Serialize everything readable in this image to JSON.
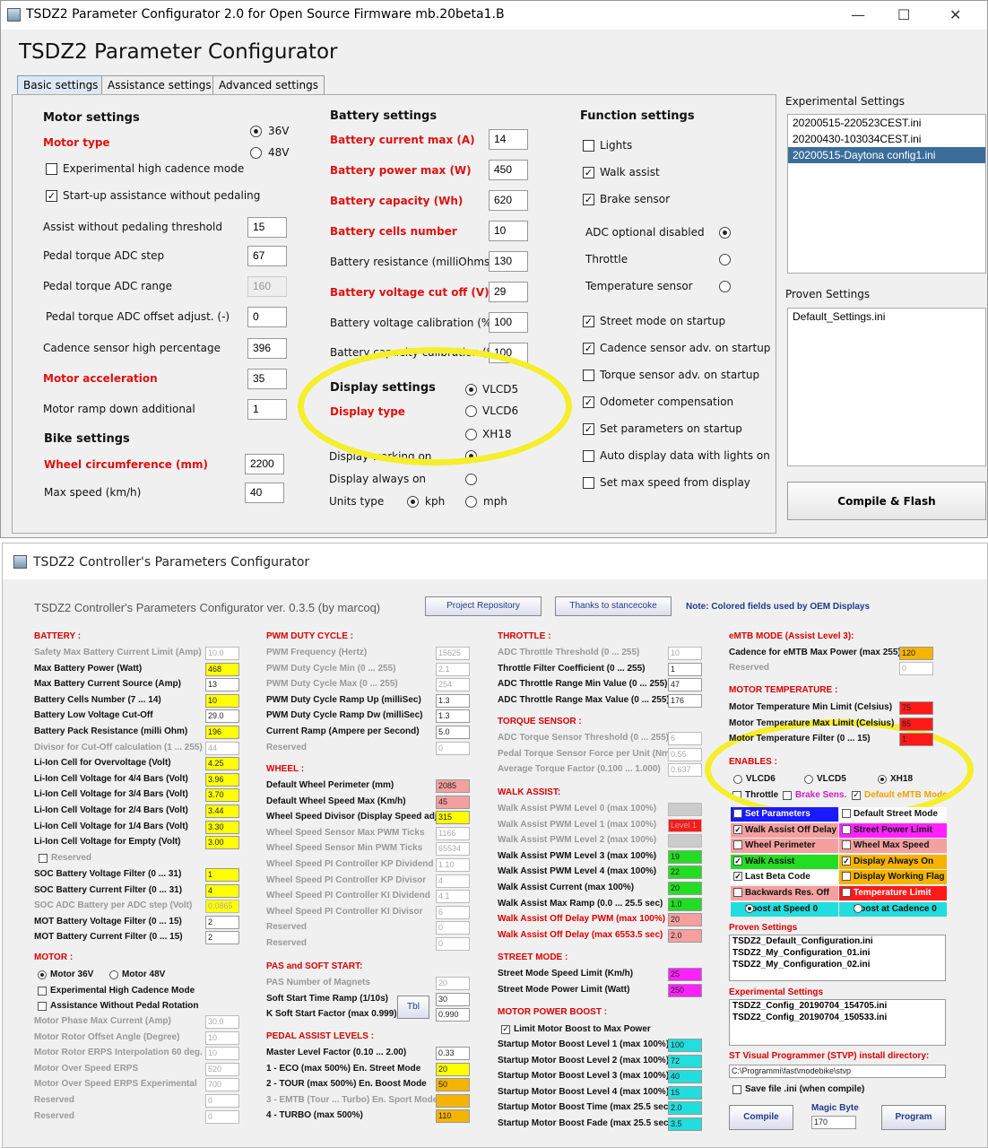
{
  "win1": {
    "title": "TSDZ2 Parameter Configurator 2.0 for Open Source Firmware mb.20beta1.B",
    "heading": "TSDZ2 Parameter Configurator",
    "tabs": [
      "Basic settings",
      "Assistance settings",
      "Advanced settings"
    ],
    "motor": {
      "heading": "Motor settings",
      "motor_type": "Motor type",
      "v36": "36V",
      "v48": "48V",
      "exp_cadence": "Experimental high cadence mode",
      "startup_assist": "Start-up assistance without pedaling",
      "fields": [
        {
          "label": "Assist without pedaling threshold",
          "value": "15"
        },
        {
          "label": "Pedal torque ADC step",
          "value": "67"
        },
        {
          "label": "Pedal torque ADC range",
          "value": "160"
        },
        {
          "label": "Pedal torque ADC offset adjust. (-)",
          "value": "0"
        },
        {
          "label": "Cadence sensor high percentage",
          "value": "396"
        },
        {
          "label": "Motor acceleration",
          "value": "35"
        },
        {
          "label": "Motor ramp down additional",
          "value": "1"
        }
      ]
    },
    "bike": {
      "heading": "Bike settings",
      "wheel_label": "Wheel circumference (mm)",
      "wheel_value": "2200",
      "speed_label": "Max speed (km/h)",
      "speed_value": "40"
    },
    "battery": {
      "heading": "Battery settings",
      "fields": [
        {
          "label": "Battery current max (A)",
          "value": "14"
        },
        {
          "label": "Battery power max (W)",
          "value": "450"
        },
        {
          "label": "Battery capacity (Wh)",
          "value": "620"
        },
        {
          "label": "Battery cells number",
          "value": "10"
        },
        {
          "label": "Battery resistance (milliOhms)",
          "value": "130"
        },
        {
          "label": "Battery voltage cut off (V)",
          "value": "29"
        },
        {
          "label": "Battery voltage calibration (%)",
          "value": "100"
        },
        {
          "label": "Battery capacity calibration (%)",
          "value": "100"
        }
      ]
    },
    "display": {
      "heading": "Display settings",
      "type_label": "Display type",
      "options": [
        "VLCD5",
        "VLCD6",
        "XH18"
      ],
      "working_on": "Display working on",
      "always_on": "Display always on",
      "units": "Units type",
      "kph": "kph",
      "mph": "mph"
    },
    "functions": {
      "heading": "Function settings",
      "lights": "Lights",
      "walk": "Walk assist",
      "brake": "Brake sensor",
      "adc_disabled": "ADC optional disabled",
      "throttle": "Throttle",
      "temp": "Temperature sensor",
      "street": "Street mode on startup",
      "cadence_adv": "Cadence sensor adv. on startup",
      "torque_adv": "Torque sensor adv. on startup",
      "odometer": "Odometer compensation",
      "set_params": "Set parameters on startup",
      "auto_display": "Auto display data with lights on",
      "max_speed_display": "Set max speed from display"
    },
    "experimental": {
      "heading": "Experimental Settings",
      "items": [
        "20200515-220523CEST.ini",
        "20200430-103034CEST.ini",
        "20200515-Daytona config1.ini"
      ]
    },
    "proven": {
      "heading": "Proven Settings",
      "items": [
        "Default_Settings.ini"
      ]
    },
    "compile": "Compile & Flash"
  },
  "win2": {
    "title": "TSDZ2 Controller's Parameters Configurator",
    "heading": "TSDZ2 Controller's Parameters Configurator ver. 0.3.5 (by marcoq)",
    "repo_btn": "Project Repository",
    "thanks_btn": "Thanks to stancecoke",
    "note": "Note: Colored fields used by OEM Displays",
    "battery": {
      "heading": "BATTERY :",
      "rows": [
        {
          "l": "Safety Max Battery Current Limit (Amp)",
          "v": "10.0"
        },
        {
          "l": "Max Battery Power (Watt)",
          "v": "468"
        },
        {
          "l": "Max Battery Current Source (Amp)",
          "v": "13"
        },
        {
          "l": "Battery Cells Number (7 ... 14)",
          "v": "10"
        },
        {
          "l": "Battery Low Voltage Cut-Off",
          "v": "29.0"
        },
        {
          "l": "Battery Pack Resistance (milli Ohm)",
          "v": "196"
        },
        {
          "l": "Divisor for Cut-Off calculation (1 ... 255)",
          "v": "44"
        },
        {
          "l": "Li-Ion Cell for Overvoltage (Volt)",
          "v": "4.25"
        },
        {
          "l": "Li-Ion Cell Voltage for 4/4 Bars (Volt)",
          "v": "3.96"
        },
        {
          "l": "Li-Ion Cell Voltage for 3/4 Bars (Volt)",
          "v": "3.70"
        },
        {
          "l": "Li-Ion Cell Voltage for 2/4 Bars (Volt)",
          "v": "3.44"
        },
        {
          "l": "Li-Ion Cell Voltage for 1/4 Bars (Volt)",
          "v": "3.30"
        },
        {
          "l": "Li-Ion Cell Voltage for Empty (Volt)",
          "v": "3.00"
        }
      ],
      "reserved": "Reserved",
      "rows2": [
        {
          "l": "SOC Battery Voltage Filter (0 ... 31)",
          "v": "1"
        },
        {
          "l": "SOC Battery Current Filter (0 ... 31)",
          "v": "4"
        },
        {
          "l": "SOC ADC Battery per ADC step (Volt)",
          "v": "0.0865"
        },
        {
          "l": "MOT Battery Voltage Filter (0 ... 15)",
          "v": "2"
        },
        {
          "l": "MOT Battery Current Filter (0 ... 15)",
          "v": "2"
        }
      ]
    },
    "motor": {
      "heading": "MOTOR :",
      "m36": "Motor 36V",
      "m48": "Motor 48V",
      "exp": "Experimental High Cadence Mode",
      "assist": "Assistance Without Pedal Rotation",
      "rows": [
        {
          "l": "Motor Phase Max Current (Amp)",
          "v": "30.0"
        },
        {
          "l": "Motor Rotor Offset Angle (Degree)",
          "v": "10"
        },
        {
          "l": "Motor Rotor ERPS Interpolation 60 deg.",
          "v": "10"
        },
        {
          "l": "Motor Over Speed ERPS",
          "v": "520"
        },
        {
          "l": "Motor Over Speed ERPS Experimental",
          "v": "700"
        },
        {
          "l": "Reserved",
          "v": "0"
        },
        {
          "l": "Reserved",
          "v": "0"
        }
      ]
    },
    "pwm": {
      "heading": "PWM DUTY CYCLE :",
      "rows": [
        {
          "l": "PWM Frequency (Hertz)",
          "v": "15625"
        },
        {
          "l": "PWM Duty Cycle Min (0 ... 255)",
          "v": "2.1"
        },
        {
          "l": "PWM Duty Cycle Max (0 ... 255)",
          "v": "254"
        },
        {
          "l": "PWM Duty Cycle Ramp Up (milliSec)",
          "v": "1.3"
        },
        {
          "l": "PWM Duty Cycle Ramp Dw (milliSec)",
          "v": "1.3"
        },
        {
          "l": "Current Ramp (Ampere per Second)",
          "v": "5.0"
        },
        {
          "l": "Reserved",
          "v": "0"
        }
      ]
    },
    "wheel": {
      "heading": "WHEEL :",
      "rows": [
        {
          "l": "Default Wheel Perimeter (mm)",
          "v": "2085"
        },
        {
          "l": "Default Wheel Speed Max (Km/h)",
          "v": "45"
        },
        {
          "l": "Wheel Speed Divisor (Display Speed adj)",
          "v": "315"
        },
        {
          "l": "Wheel Speed Sensor Max PWM Ticks",
          "v": "1166"
        },
        {
          "l": "Wheel Speed Sensor Min PWM Ticks",
          "v": "65534"
        },
        {
          "l": "Wheel Speed PI Controller KP Dividend",
          "v": "1.10"
        },
        {
          "l": "Wheel Speed PI Controller KP Divisor",
          "v": "4"
        },
        {
          "l": "Wheel Speed PI Controller KI Dividend",
          "v": "4.1"
        },
        {
          "l": "Wheel Speed PI Controller KI Divisor",
          "v": "6"
        },
        {
          "l": "Reserved",
          "v": "0"
        },
        {
          "l": "Reserved",
          "v": "0"
        }
      ]
    },
    "pas": {
      "heading": "PAS and SOFT START:",
      "rows": [
        {
          "l": "PAS Number of Magnets",
          "v": "20"
        },
        {
          "l": "Soft Start Time Ramp (1/10s)",
          "v": "30"
        },
        {
          "l": "K Soft Start Factor (max 0.999)",
          "v": "0.990"
        }
      ],
      "tbl": "Tbl"
    },
    "pedal": {
      "heading": "PEDAL ASSIST LEVELS :",
      "rows": [
        {
          "l": "Master Level Factor (0.10 ... 2.00)",
          "v": "0.33"
        },
        {
          "l": "1 - ECO    (max 500%) En. Street Mode",
          "v": "20"
        },
        {
          "l": "2 - TOUR  (max 500%) En. Boost Mode",
          "v": "50"
        },
        {
          "l": "3 - EMTB  (Tour ... Turbo) En. Sport Mode",
          "v": ""
        },
        {
          "l": "4 - TURBO (max 500%)",
          "v": "110"
        }
      ]
    },
    "throttle": {
      "heading": "THROTTLE :",
      "rows": [
        {
          "l": "ADC Throttle Threshold (0 ... 255)",
          "v": "10"
        },
        {
          "l": "Throttle Filter Coefficient (0 ... 255)",
          "v": "1"
        },
        {
          "l": "ADC Throttle Range Min Value (0 ... 255)",
          "v": "47"
        },
        {
          "l": "ADC Throttle Range Max Value (0 ... 255)",
          "v": "176"
        }
      ]
    },
    "torque": {
      "heading": "TORQUE SENSOR :",
      "rows": [
        {
          "l": "ADC Torque Sensor Threshold (0 ... 255)",
          "v": "6"
        },
        {
          "l": "Pedal Torque Sensor Force per Unit (Nm)",
          "v": "0.55"
        },
        {
          "l": "Average Torque Factor (0.100 ... 1.000)",
          "v": "0.637"
        }
      ]
    },
    "walk": {
      "heading": "WALK ASSIST:",
      "rows": [
        {
          "l": "Walk Assist PWM Level 0 (max 100%)",
          "v": ""
        },
        {
          "l": "Walk Assist PWM Level 1 (max 100%)",
          "v": "Level 1"
        },
        {
          "l": "Walk Assist PWM Level 2 (max 100%)",
          "v": ""
        },
        {
          "l": "Walk Assist PWM Level 3 (max 100%)",
          "v": "19"
        },
        {
          "l": "Walk Assist PWM Level 4 (max 100%)",
          "v": "22"
        },
        {
          "l": "Walk Assist Current (max 100%)",
          "v": "20"
        },
        {
          "l": "Walk Assist Max Ramp (0.0 ... 25.5 sec)",
          "v": "1.0"
        },
        {
          "l": "Walk Assist Off Delay PWM (max 100%)",
          "v": "20"
        },
        {
          "l": "Walk Assist Off Delay (max 6553.5 sec)",
          "v": "2.0"
        }
      ]
    },
    "street": {
      "heading": "STREET MODE :",
      "rows": [
        {
          "l": "Street Mode Speed Limit (Km/h)",
          "v": "25"
        },
        {
          "l": "Street Mode Power Limit (Watt)",
          "v": "250"
        }
      ]
    },
    "boost": {
      "heading": "MOTOR POWER BOOST :",
      "limit": "Limit Motor Boost to Max Power",
      "rows": [
        {
          "l": "Startup Motor Boost Level 1 (max 100%)",
          "v": "100"
        },
        {
          "l": "Startup Motor Boost Level 2 (max 100%)",
          "v": "72"
        },
        {
          "l": "Startup Motor Boost Level 3 (max 100%)",
          "v": "40"
        },
        {
          "l": "Startup Motor Boost Level 4 (max 100%)",
          "v": "15"
        },
        {
          "l": "Startup Motor Boost Time (max 25.5 sec)",
          "v": "2.0"
        },
        {
          "l": "Startup Motor Boost Fade (max 25.5 sec)",
          "v": "3.5"
        }
      ]
    },
    "emtb": {
      "heading": "eMTB MODE (Assist Level 3):",
      "cad_label": "Cadence for eMTB Max Power (max 255)",
      "cad_value": "120",
      "reserved": "Reserved",
      "res_value": "0"
    },
    "temp": {
      "heading": "MOTOR TEMPERATURE :",
      "rows": [
        {
          "l": "Motor Temperature Min Limit (Celsius)",
          "v": "75"
        },
        {
          "l": "Motor Temperature Max Limit (Celsius)",
          "v": "85"
        },
        {
          "l": "Motor Temperature Filter (0 ... 15)",
          "v": "1"
        }
      ]
    },
    "enables": {
      "heading": "ENABLES :",
      "displays": [
        "VLCD6",
        "VLCD5",
        "XH18"
      ],
      "throttle": "Throttle",
      "brake": "Brake Sens.",
      "default_emtb": "Default eMTB Mode",
      "left": [
        "Set Parameters",
        "Walk Assist Off Delay",
        "Wheel Perimeter",
        "Walk Assist",
        "Last Beta Code",
        "Backwards Res. Off",
        "Boost at Speed 0"
      ],
      "right": [
        "Default Street Mode",
        "Street Power Limit",
        "Wheel Max Speed",
        "Display Always On",
        "Display Working Flag",
        "Temperature Limit",
        "Boost at Cadence 0"
      ]
    },
    "proven": {
      "heading": "Proven Settings",
      "items": [
        "TSDZ2_Default_Configuration.ini",
        "TSDZ2_My_Configuration_01.ini",
        "TSDZ2_My_Configuration_02.ini"
      ]
    },
    "experimental": {
      "heading": "Experimental Settings",
      "items": [
        "TSDZ2_Config_20190704_154705.ini",
        "TSDZ2_Config_20190704_150533.ini"
      ]
    },
    "stvp": {
      "heading": "ST Visual Programmer (STVP) install directory:",
      "path": "C:\\Programmi\\fast\\modebike\\stvp",
      "save": "Save file .ini (when compile)",
      "compile": "Compile",
      "magic_label": "Magic Byte",
      "magic_value": "170",
      "program": "Program"
    }
  }
}
